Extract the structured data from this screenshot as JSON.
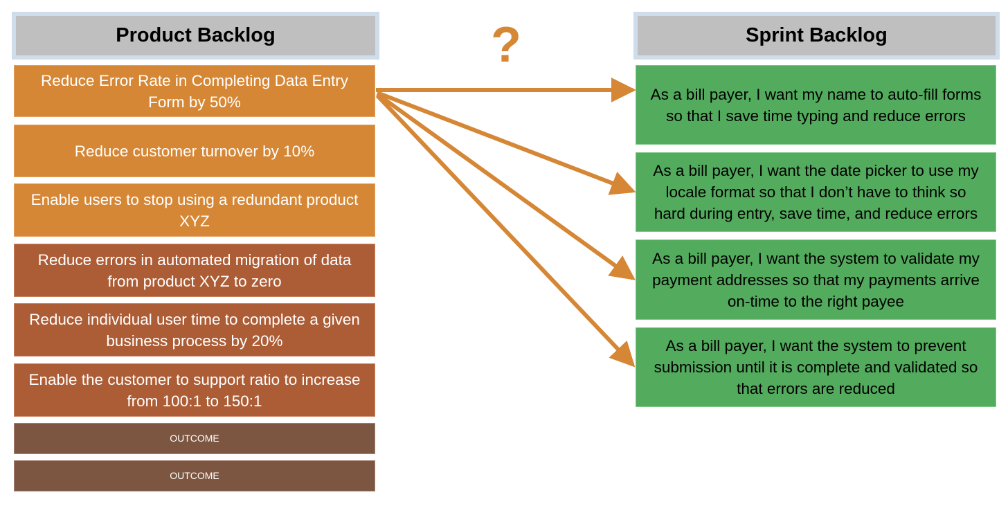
{
  "colors": {
    "arrow": "#d58735",
    "header_bg": "#bfbfbf",
    "header_border": "#cfdce9",
    "outcome_primary": "#d58735",
    "outcome_secondary": "#ad5d36",
    "outcome_placeholder": "#7c5641",
    "story": "#53ab5d"
  },
  "product_backlog": {
    "title": "Product Backlog",
    "items": [
      {
        "text": "Reduce Error Rate in Completing Data Entry Form by 50%",
        "tone": "orange"
      },
      {
        "text": "Reduce customer turnover by 10%",
        "tone": "orange"
      },
      {
        "text": "Enable users to stop using a redundant product XYZ",
        "tone": "orange"
      },
      {
        "text": "Reduce errors in automated migration of data from product XYZ to zero",
        "tone": "rust"
      },
      {
        "text": "Reduce individual user time to complete a given business process by 20%",
        "tone": "rust"
      },
      {
        "text": "Enable the customer to support ratio to increase from 100:1 to 150:1",
        "tone": "rust"
      },
      {
        "text": "OUTCOME",
        "tone": "brown"
      },
      {
        "text": "OUTCOME",
        "tone": "brown"
      }
    ]
  },
  "question_mark": "?",
  "sprint_backlog": {
    "title": "Sprint Backlog",
    "items": [
      {
        "text": "As a bill payer, I want my name to auto-fill forms so that I save time typing and reduce errors"
      },
      {
        "text": "As a bill payer, I want the date picker to use my locale format so that I don’t have to think so hard during entry, save time, and reduce errors"
      },
      {
        "text": "As a bill payer, I want the system to validate my payment addresses so that my payments arrive on-time to the right payee"
      },
      {
        "text": "As a bill payer, I want the system to prevent submission until it is complete and validated so that errors are reduced"
      }
    ]
  },
  "connections": [
    {
      "from": "product_backlog.items.0",
      "to": "sprint_backlog.items.0"
    },
    {
      "from": "product_backlog.items.0",
      "to": "sprint_backlog.items.1"
    },
    {
      "from": "product_backlog.items.0",
      "to": "sprint_backlog.items.2"
    },
    {
      "from": "product_backlog.items.0",
      "to": "sprint_backlog.items.3"
    }
  ]
}
